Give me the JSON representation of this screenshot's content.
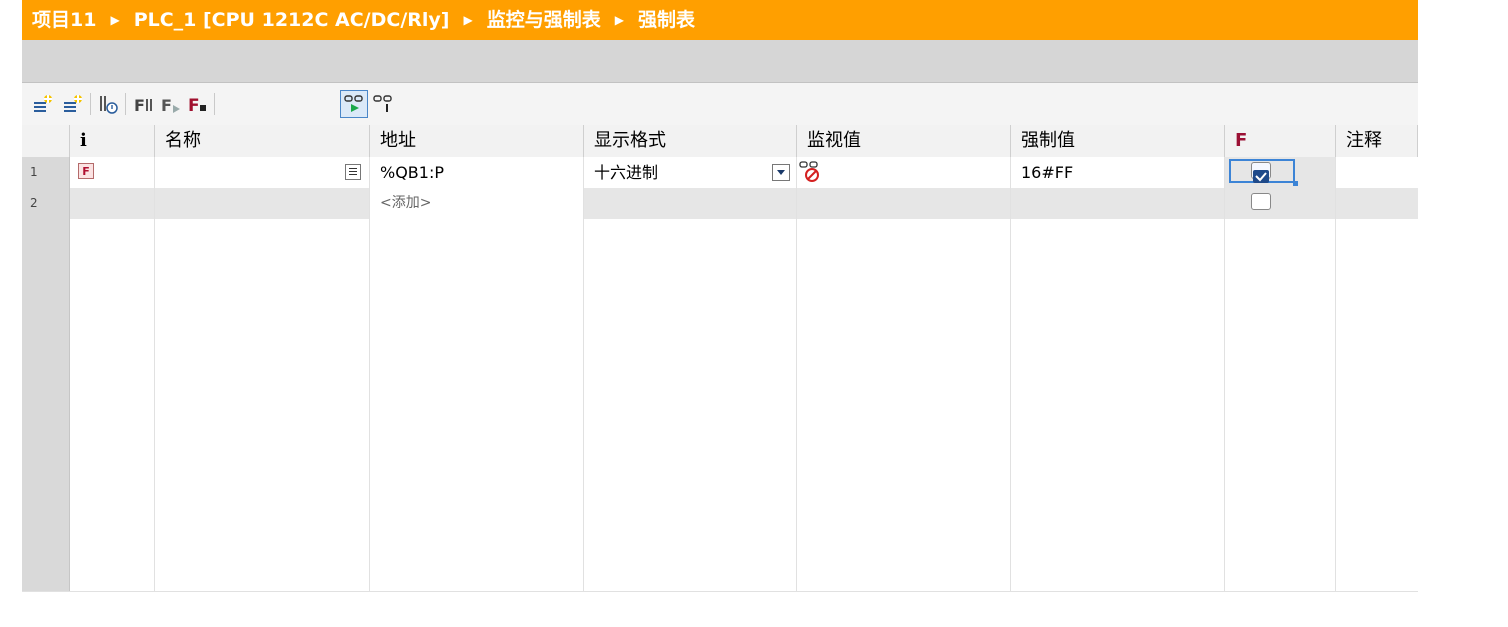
{
  "breadcrumb": [
    "项目11",
    "PLC_1 [CPU 1212C AC/DC/Rly]",
    "监控与强制表",
    "强制表"
  ],
  "toolbar": {
    "buttons": [
      "insert-row-icon",
      "add-row-icon",
      "force-history-icon",
      "force-to-plc-icon",
      "force-start-icon",
      "force-stop-icon",
      "monitor-all-icon",
      "monitor-once-icon"
    ]
  },
  "table": {
    "headers": {
      "i": "i",
      "name": "名称",
      "address": "地址",
      "format": "显示格式",
      "monitor": "监视值",
      "force_value": "强制值",
      "f": "F",
      "comment": "注释"
    },
    "rows": [
      {
        "num": "1",
        "name": "",
        "address": "%QB1:P",
        "format": "十六进制",
        "monitor_icon": "monitor-error-icon",
        "force_value": "16#FF",
        "force_checked": true,
        "comment": ""
      },
      {
        "num": "2",
        "name": "",
        "address": "<添加>",
        "format": "",
        "force_value": "",
        "force_checked": false,
        "comment": ""
      }
    ],
    "status_icon_label": "F",
    "empty_row_count": 12
  }
}
